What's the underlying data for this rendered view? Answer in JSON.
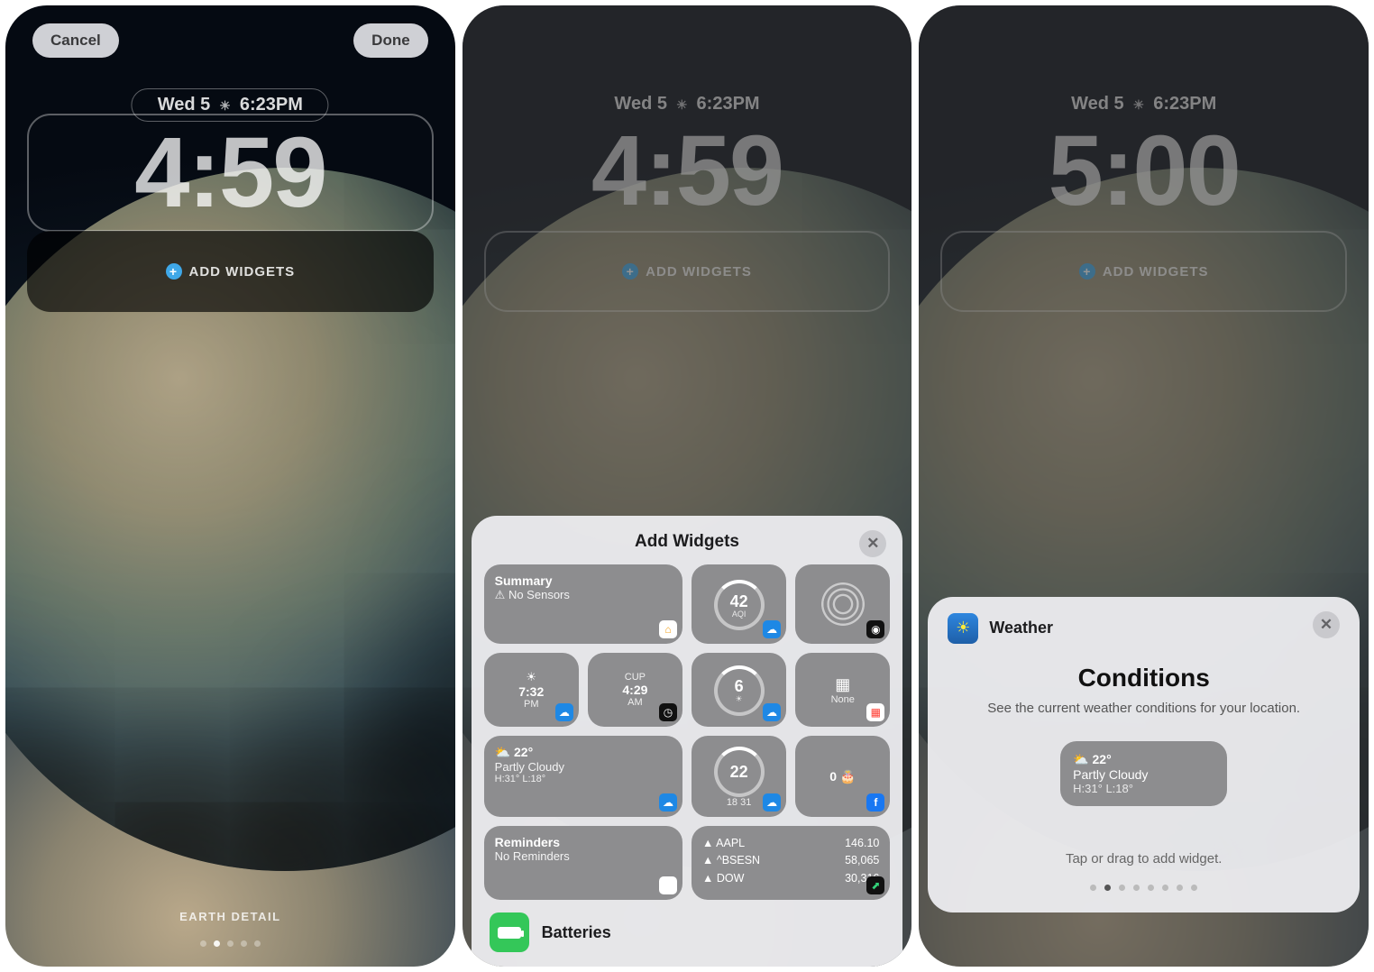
{
  "panel1": {
    "cancel": "Cancel",
    "done": "Done",
    "date": "Wed 5",
    "timeSuffix": "6:23PM",
    "bigTime": "4:59",
    "addWidgets": "ADD WIDGETS",
    "wallpaper": "EARTH DETAIL"
  },
  "panel2": {
    "date": "Wed 5",
    "timeSuffix": "6:23PM",
    "bigTime": "4:59",
    "addWidgets": "ADD WIDGETS",
    "sheetTitle": "Add Widgets",
    "summary": {
      "title": "Summary",
      "sub": "No Sensors"
    },
    "aqi": {
      "value": "42",
      "unit": "AQI"
    },
    "city1": {
      "time": "7:32",
      "ampm": "PM"
    },
    "city2": {
      "code": "CUP",
      "time": "4:29",
      "ampm": "AM"
    },
    "uv": {
      "value": "6"
    },
    "cal": {
      "icon": "📅",
      "label": "None"
    },
    "weather": {
      "temp": "22°",
      "cond": "Partly Cloudy",
      "hl": "H:31° L:18°"
    },
    "weather2": {
      "value": "22",
      "range": "18    31"
    },
    "birthday": {
      "count": "0"
    },
    "reminders": {
      "title": "Reminders",
      "sub": "No Reminders"
    },
    "stocks": [
      {
        "sym": "▲ AAPL",
        "val": "146.10"
      },
      {
        "sym": "▲ ^BSESN",
        "val": "58,065"
      },
      {
        "sym": "▲ DOW",
        "val": "30,316"
      }
    ],
    "category": "Batteries"
  },
  "panel3": {
    "date": "Wed 5",
    "timeSuffix": "6:23PM",
    "bigTime": "5:00",
    "addWidgets": "ADD WIDGETS",
    "appName": "Weather",
    "heading": "Conditions",
    "desc": "See the current weather conditions for your location.",
    "widget": {
      "temp": "22°",
      "cond": "Partly Cloudy",
      "hl": "H:31° L:18°"
    },
    "hint": "Tap or drag to add widget."
  }
}
